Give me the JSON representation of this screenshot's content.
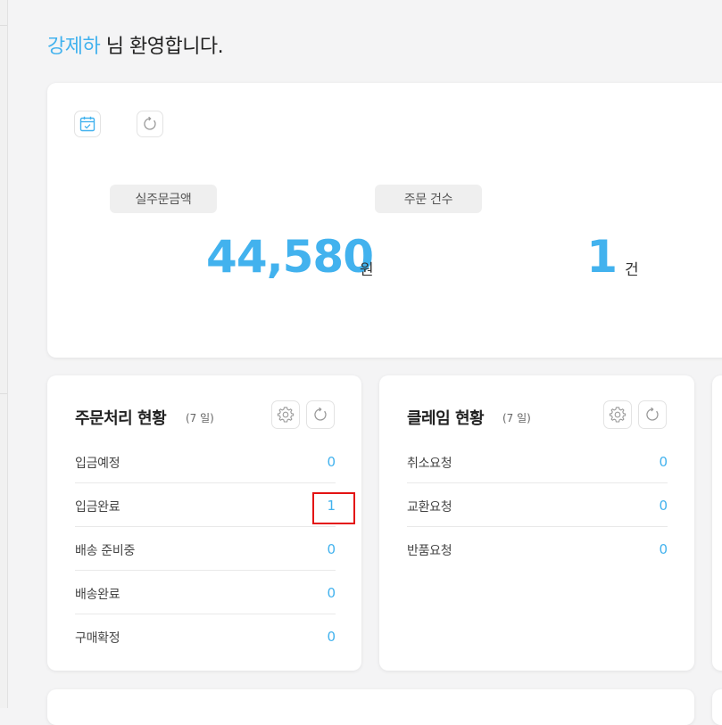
{
  "welcome": {
    "name": "강제하",
    "message": "님 환영합니다."
  },
  "summary": {
    "calendar_icon": "calendar-check-icon",
    "refresh_icon": "refresh-icon",
    "stats": [
      {
        "label": "실주문금액",
        "value": "44,580",
        "unit": "원"
      },
      {
        "label": "주문 건수",
        "value": "1",
        "unit": "건"
      }
    ]
  },
  "order_status": {
    "title": "주문처리 현황",
    "period": "(7 일)",
    "rows": [
      {
        "label": "입금예정",
        "value": "0"
      },
      {
        "label": "입금완료",
        "value": "1"
      },
      {
        "label": "배송 준비중",
        "value": "0"
      },
      {
        "label": "배송완료",
        "value": "0"
      },
      {
        "label": "구매확정",
        "value": "0"
      }
    ]
  },
  "claim_status": {
    "title": "클레임 현황",
    "period": "(7 일)",
    "rows": [
      {
        "label": "취소요청",
        "value": "0"
      },
      {
        "label": "교환요청",
        "value": "0"
      },
      {
        "label": "반품요청",
        "value": "0"
      }
    ]
  },
  "colors": {
    "accent": "#42b2ee",
    "highlight": "#e31313",
    "background": "#f4f4f5"
  }
}
